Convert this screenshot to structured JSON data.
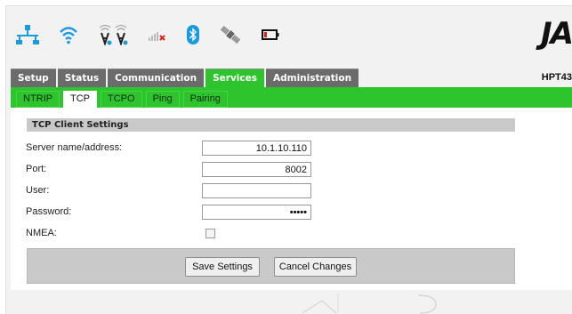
{
  "logo": {
    "text": "JA"
  },
  "model": "HPT43",
  "status_icons": [
    "network-icon",
    "wifi-icon",
    "radio-antenna-icon",
    "signal-bars-icon",
    "bluetooth-icon",
    "satellite-icon",
    "battery-icon"
  ],
  "colors": {
    "accent": "#2ec42e",
    "tab_inactive": "#6b6b6b",
    "section_bg": "#c9c9c9",
    "icon_blue": "#1a9be0",
    "alert_red": "#e0201a"
  },
  "main_tabs": [
    {
      "label": "Setup",
      "active": false
    },
    {
      "label": "Status",
      "active": false
    },
    {
      "label": "Communication",
      "active": false
    },
    {
      "label": "Services",
      "active": true
    },
    {
      "label": "Administration",
      "active": false
    }
  ],
  "sub_tabs": [
    {
      "label": "NTRIP",
      "active": false
    },
    {
      "label": "TCP",
      "active": true
    },
    {
      "label": "TCPO",
      "active": false
    },
    {
      "label": "Ping",
      "active": false
    },
    {
      "label": "Pairing",
      "active": false
    }
  ],
  "section": {
    "title": "TCP Client Settings"
  },
  "fields": {
    "server": {
      "label": "Server name/address:",
      "value": "10.1.10.110"
    },
    "port": {
      "label": "Port:",
      "value": "8002"
    },
    "user": {
      "label": "User:",
      "value": ""
    },
    "password": {
      "label": "Password:",
      "value": "•••••"
    },
    "nmea": {
      "label": "NMEA:",
      "checked": false
    }
  },
  "buttons": {
    "save": "Save Settings",
    "cancel": "Cancel Changes"
  }
}
